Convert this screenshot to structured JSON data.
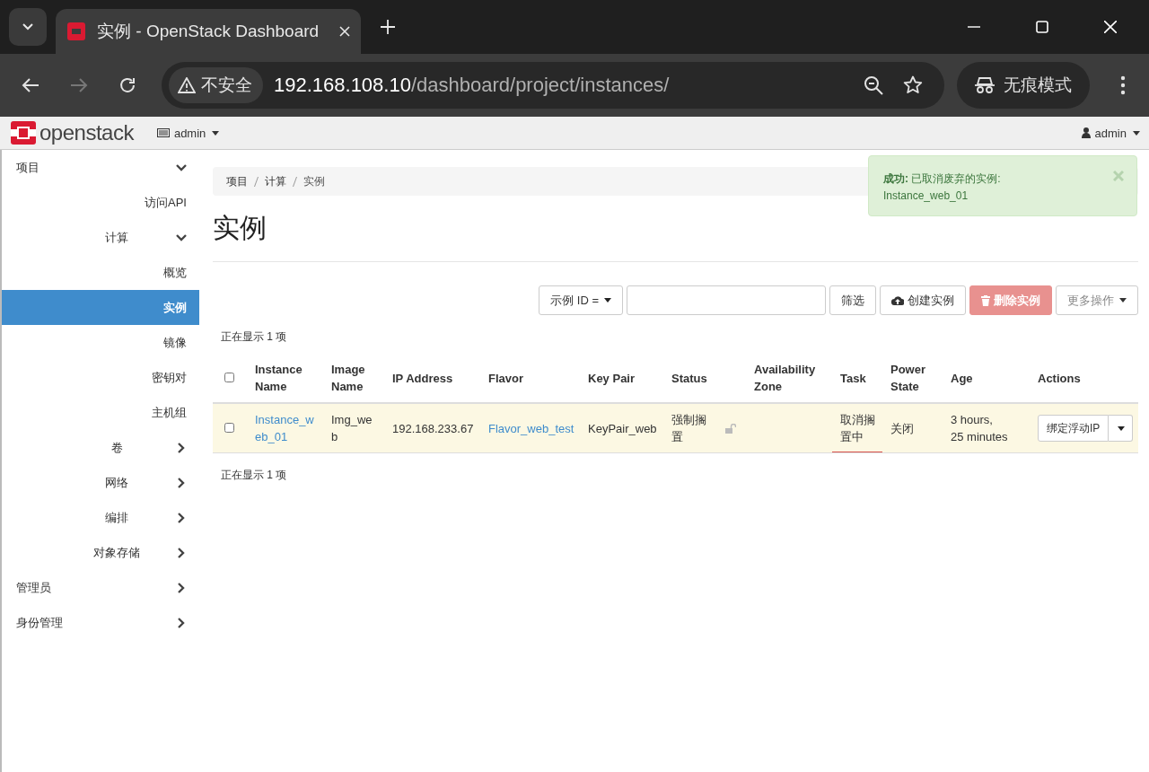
{
  "browser": {
    "tab_title": "实例 - OpenStack Dashboard",
    "security": "不安全",
    "url_host": "192.168.108.10",
    "url_path": "/dashboard/project/instances/",
    "incognito": "无痕模式"
  },
  "navbar": {
    "brand": "openstack",
    "project": "admin",
    "user": "admin"
  },
  "sidebar": [
    {
      "label": "项目",
      "expanded": true,
      "children": [
        {
          "kind": "item",
          "label": "访问API",
          "selected": false
        },
        {
          "kind": "group",
          "label": "计算",
          "expanded": true,
          "children": [
            {
              "label": "概览",
              "selected": false
            },
            {
              "label": "实例",
              "selected": true
            },
            {
              "label": "镜像",
              "selected": false
            },
            {
              "label": "密钥对",
              "selected": false
            },
            {
              "label": "主机组",
              "selected": false
            }
          ]
        },
        {
          "kind": "group",
          "label": "卷",
          "expanded": false
        },
        {
          "kind": "group",
          "label": "网络",
          "expanded": false
        },
        {
          "kind": "group",
          "label": "编排",
          "expanded": false
        },
        {
          "kind": "group",
          "label": "对象存储",
          "expanded": false
        }
      ]
    },
    {
      "label": "管理员",
      "expanded": false
    },
    {
      "label": "身份管理",
      "expanded": false
    }
  ],
  "breadcrumb": [
    "项目",
    "计算",
    "实例"
  ],
  "page_title": "实例",
  "alert": {
    "title": "成功:",
    "message": "已取消废弃的实例: Instance_web_01"
  },
  "toolbar": {
    "filter_field": "示例 ID =",
    "filter_button": "筛选",
    "create_button": "创建实例",
    "delete_button": "删除实例",
    "delete_disabled": true,
    "more_button": "更多操作",
    "more_disabled": true
  },
  "count_top": "正在显示 1 项",
  "table": {
    "columns": [
      "Instance Name",
      "Image Name",
      "IP Address",
      "Flavor",
      "Key Pair",
      "Status",
      "Availability Zone",
      "Task",
      "Power State",
      "Age",
      "Actions"
    ],
    "select_all_checked": false,
    "rows": [
      {
        "checked": false,
        "instance_name": "Instance_web_01",
        "image_name": "Img_web",
        "ip_address": "192.168.233.67",
        "flavor": "Flavor_web_test",
        "key_pair": "KeyPair_web",
        "status": "强制搁置",
        "locked": false,
        "task": "取消搁置中",
        "task_in_progress": true,
        "power_state": "关闭",
        "age": "3 hours, 25 minutes",
        "action": "绑定浮动IP"
      }
    ]
  },
  "count_bottom": "正在显示 1 项"
}
